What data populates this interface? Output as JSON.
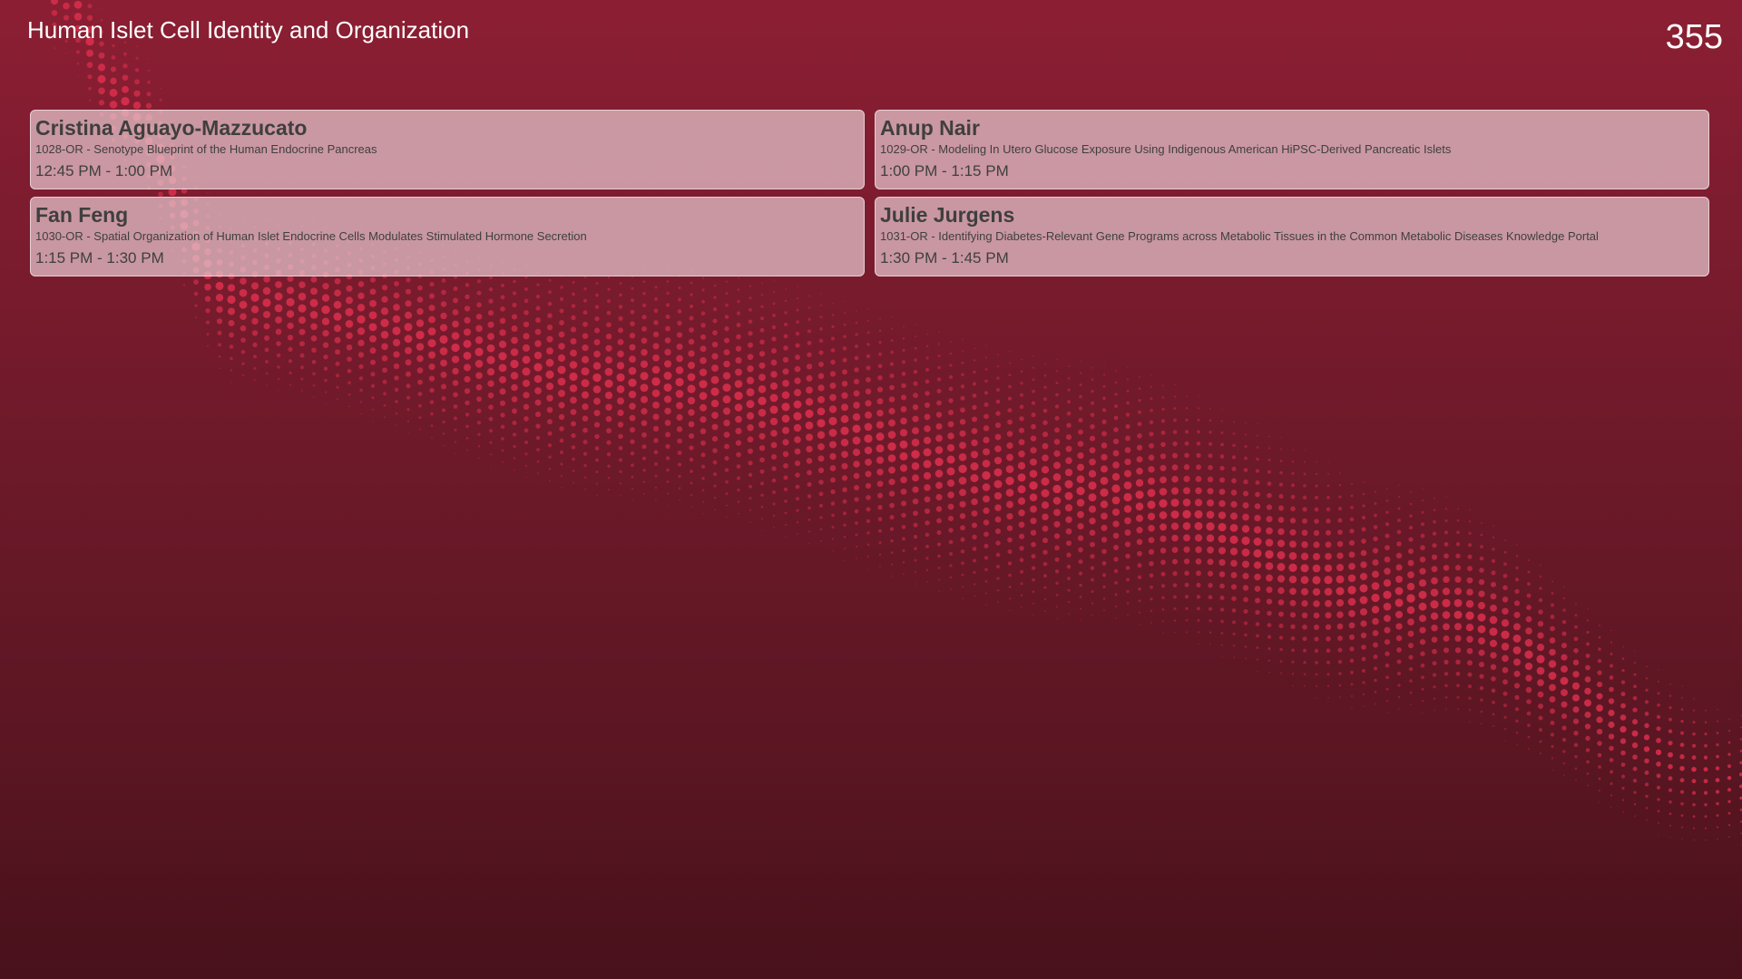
{
  "header": {
    "session_title": "Human Islet Cell Identity and Organization",
    "room": "355"
  },
  "talks": [
    {
      "speaker": "Cristina Aguayo-Mazzucato",
      "abstract": "1028-OR - Senotype Blueprint of the Human Endocrine Pancreas",
      "time": "12:45 PM - 1:00 PM"
    },
    {
      "speaker": "Anup Nair",
      "abstract": "1029-OR - Modeling In Utero Glucose Exposure Using Indigenous American HiPSC-Derived Pancreatic Islets",
      "time": "1:00 PM - 1:15 PM"
    },
    {
      "speaker": "Fan Feng",
      "abstract": "1030-OR - Spatial Organization of Human Islet Endocrine Cells Modulates Stimulated Hormone Secretion",
      "time": "1:15 PM - 1:30 PM"
    },
    {
      "speaker": "Julie Jurgens",
      "abstract": "1031-OR - Identifying Diabetes-Relevant Gene Programs across Metabolic Tissues in the Common Metabolic Diseases Knowledge Portal",
      "time": "1:30 PM - 1:45 PM"
    }
  ],
  "colors": {
    "background_top": "#8c1e33",
    "background_bottom": "#48111b",
    "dot_accent": "#e0304f",
    "card_fill": "#e6c8ce",
    "card_text": "#3f3f3f"
  }
}
